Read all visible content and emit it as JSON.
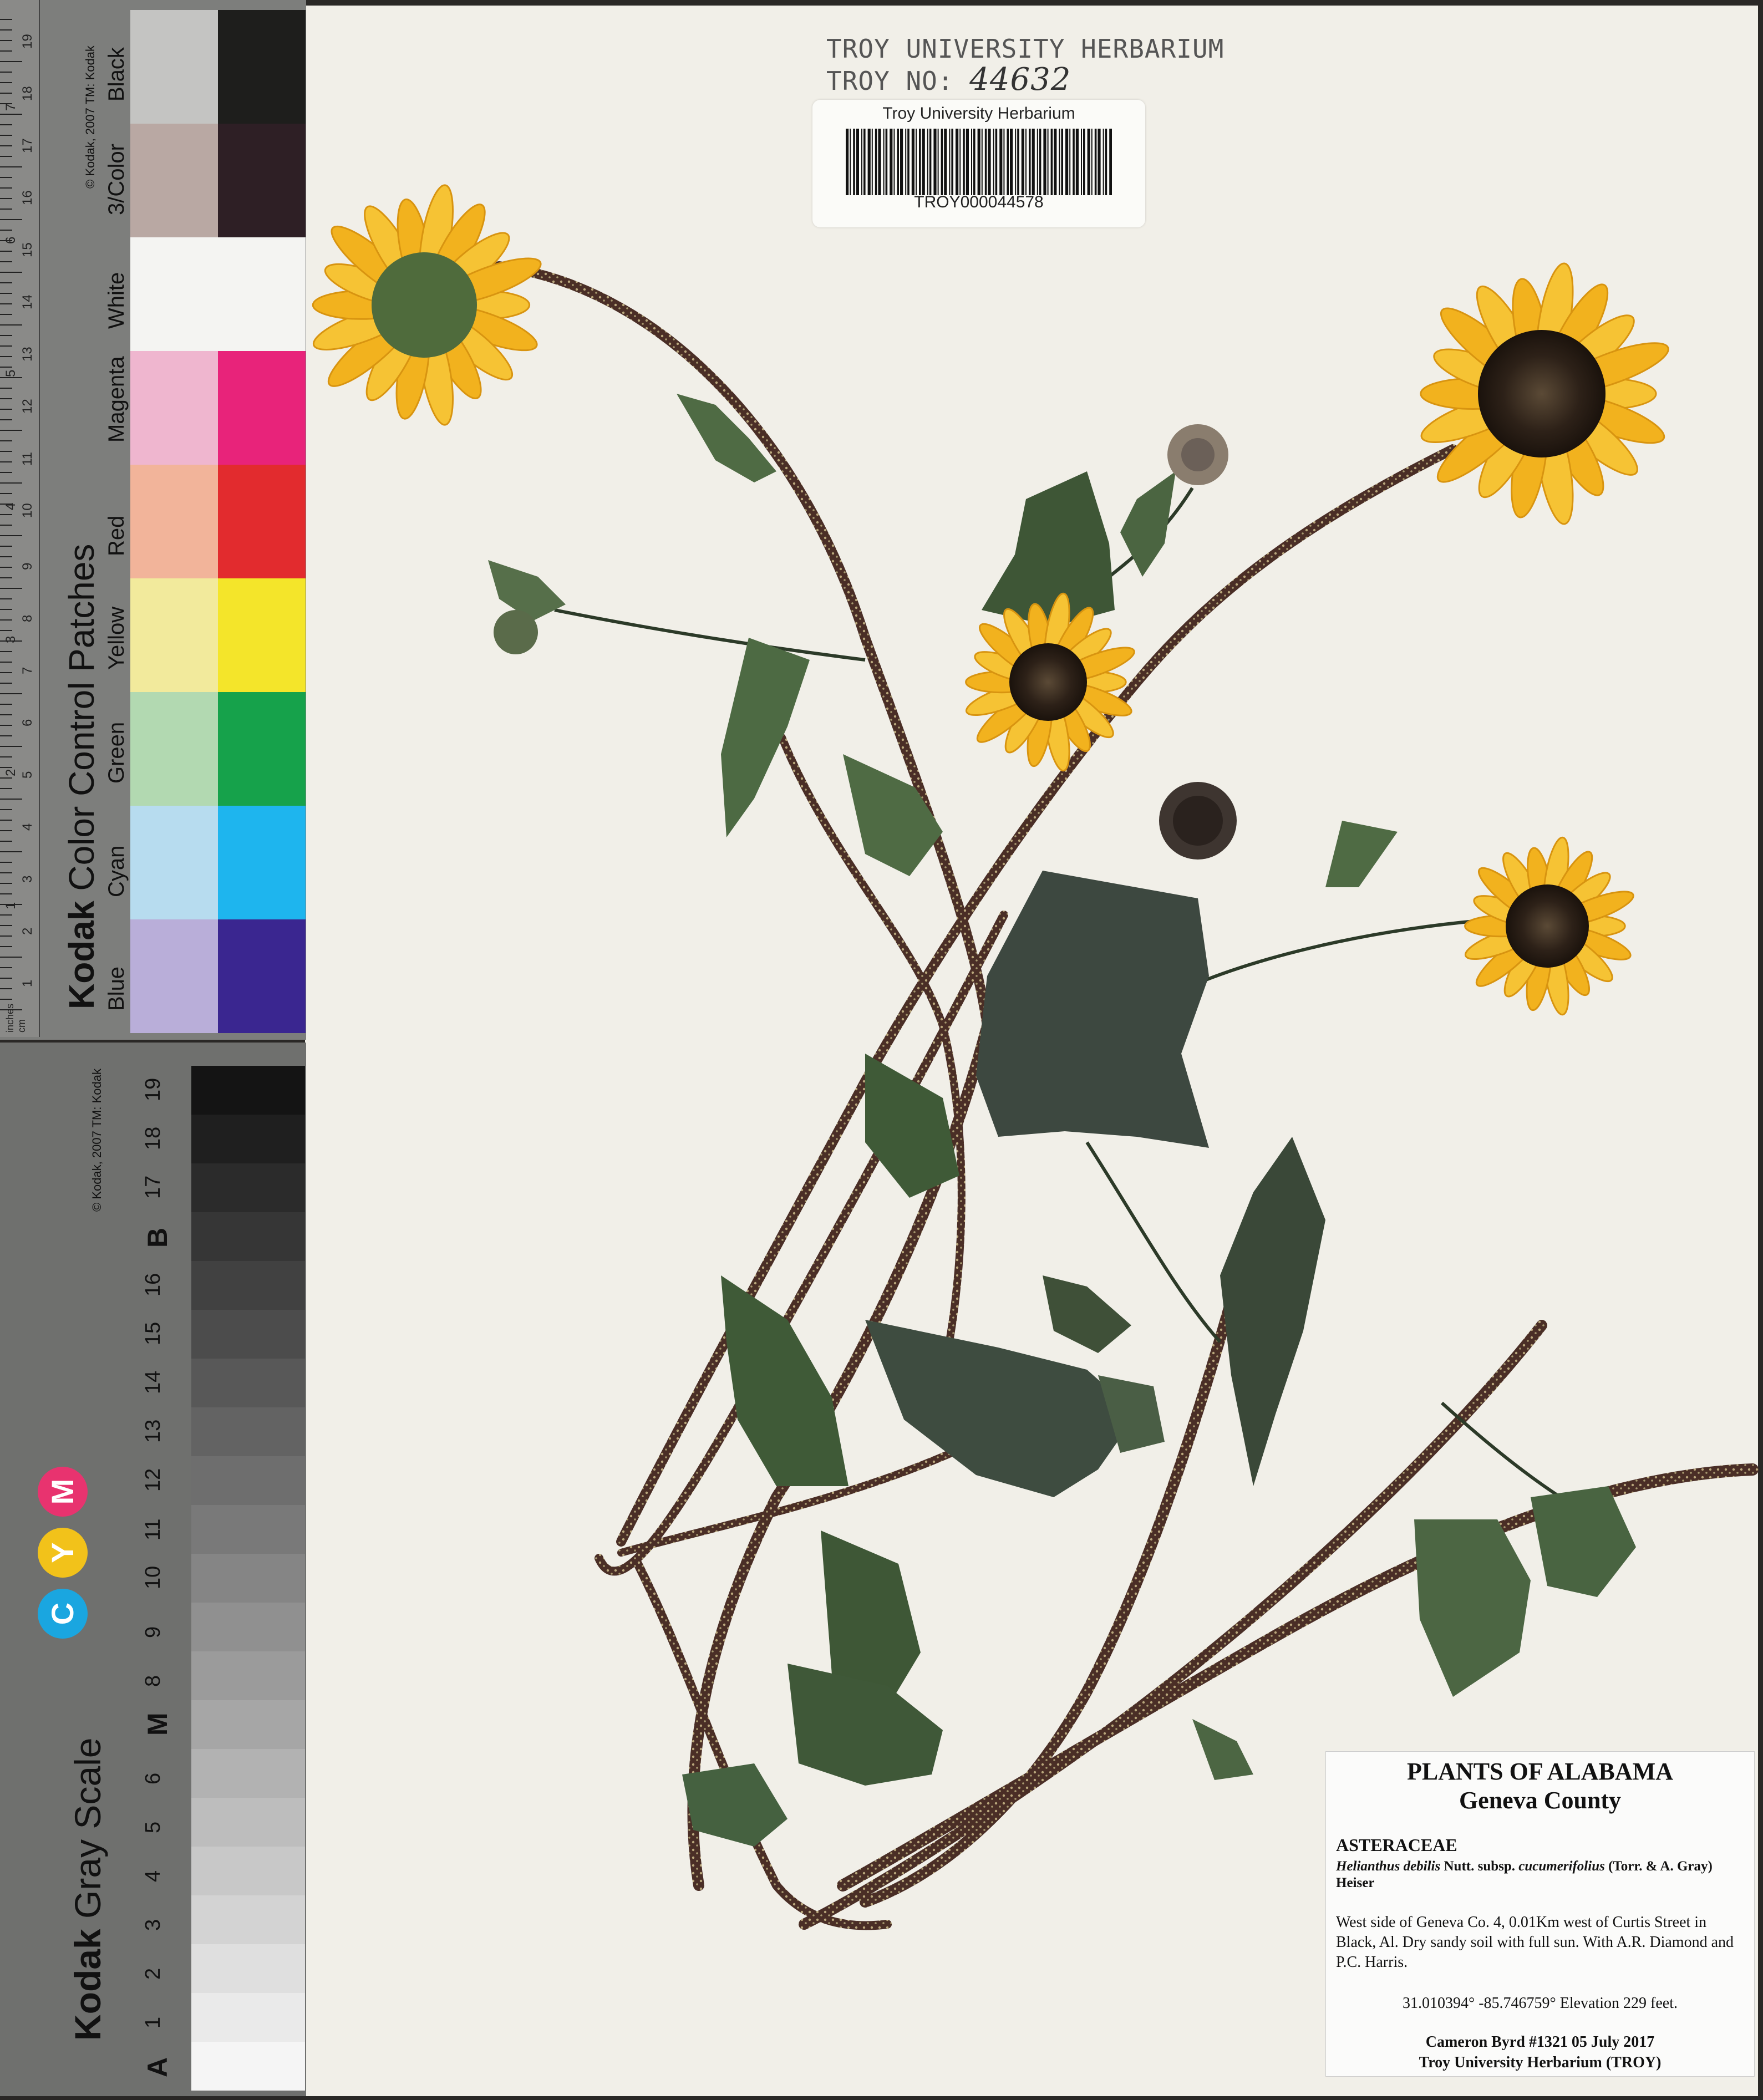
{
  "color_strip": {
    "title_brand": "Kodak",
    "title_rest": "Color Control Patches",
    "copyright": "© Kodak, 2007 TM: Kodak",
    "ruler_units": [
      "inches",
      "cm"
    ],
    "ruler_cm": [
      "1",
      "2",
      "3",
      "4",
      "5",
      "6",
      "7",
      "8",
      "9",
      "10",
      "11",
      "12",
      "13",
      "14",
      "15",
      "16",
      "17",
      "18",
      "19"
    ],
    "ruler_in": [
      "1",
      "2",
      "3",
      "4",
      "5",
      "6",
      "7"
    ],
    "patches": [
      {
        "name": "Black",
        "light": "#c4c4c2",
        "dark": "#1e1e1c"
      },
      {
        "name": "3/Color",
        "light": "#b9a8a3",
        "dark": "#2e1f25"
      },
      {
        "name": "White",
        "light": "#f4f4f2",
        "dark": "#f4f4f2"
      },
      {
        "name": "Magenta",
        "light": "#efb6cf",
        "dark": "#e8237a"
      },
      {
        "name": "Red",
        "light": "#f2b49a",
        "dark": "#e22b2e"
      },
      {
        "name": "Yellow",
        "light": "#f2ea9c",
        "dark": "#f4e52a"
      },
      {
        "name": "Green",
        "light": "#b2d9b1",
        "dark": "#16a24b"
      },
      {
        "name": "Cyan",
        "light": "#b7dcef",
        "dark": "#1eb5ee"
      },
      {
        "name": "Blue",
        "light": "#b9aed9",
        "dark": "#3a2690"
      }
    ]
  },
  "gray_strip": {
    "title_brand": "Kodak",
    "title_rest": "Gray Scale",
    "copyright": "© Kodak, 2007 TM: Kodak",
    "steps": [
      "A",
      "1",
      "2",
      "3",
      "4",
      "5",
      "6",
      "M",
      "8",
      "9",
      "10",
      "11",
      "12",
      "13",
      "14",
      "15",
      "16",
      "B",
      "17",
      "18",
      "19"
    ],
    "cym": [
      {
        "letter": "C",
        "color": "#1aa6e0"
      },
      {
        "letter": "Y",
        "color": "#f2c21a"
      },
      {
        "letter": "M",
        "color": "#e8336f"
      }
    ]
  },
  "header": {
    "stamp_line1": "TROY UNIVERSITY HERBARIUM",
    "stamp_line2_prefix": "TROY NO:",
    "troy_no": "44632",
    "barcode_top": "Troy University Herbarium",
    "barcode_number": "TROY000044578"
  },
  "label": {
    "title": "PLANTS OF ALABAMA",
    "county": "Geneva County",
    "family": "ASTERACEAE",
    "genus_species": "Helianthus debilis",
    "author1": "Nutt. subsp.",
    "subspecies": "cucumerifolius",
    "author2": "(Torr. & A. Gray) Heiser",
    "locality": "West side of Geneva Co. 4, 0.01Km west of Curtis Street in Black, Al. Dry sandy soil with full sun. With A.R. Diamond and P.C. Harris.",
    "coordinates": "31.010394° -85.746759° Elevation 229 feet.",
    "collector": "Cameron Byrd #1321   05 July 2017",
    "institution": "Troy University Herbarium (TROY)"
  }
}
